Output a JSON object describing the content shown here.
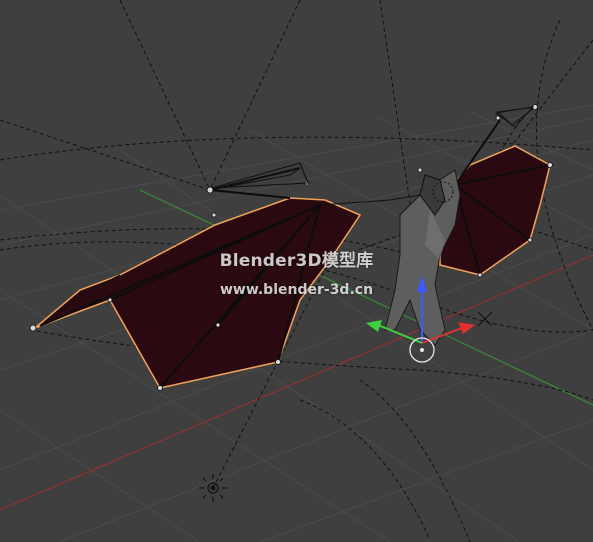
{
  "viewport": {
    "background": "#3f3f3f",
    "grid_color": "#4a4a4a",
    "x_axis_color": "#9a2f2f",
    "y_axis_color": "#3f8f3f"
  },
  "objects": {
    "model": "bat-creature",
    "wing_color": "#2a0a0f",
    "selection_outline_color": "#f2a35a"
  },
  "widgets": {
    "transform_gizmo": {
      "x_color": "#e03030",
      "y_color": "#3fd03f",
      "z_color": "#3a5bff"
    },
    "light_icon": "light-lamp-icon",
    "camera_icons": [
      "camera-icon",
      "camera-icon"
    ],
    "cursor_3d_icon": "3d-cursor-icon"
  },
  "watermark": {
    "title": "Blender3D模型库",
    "url": "www.blender-3d.cn"
  }
}
